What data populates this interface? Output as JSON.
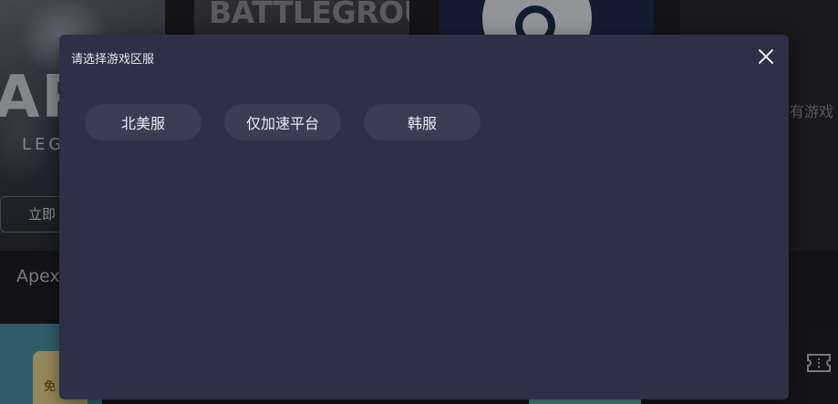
{
  "background": {
    "apex_tile": {
      "logo_text": "AP",
      "subtitle": "LEG",
      "play_button_label": "立即"
    },
    "pubg_tile": {
      "title": "BATTLEGROUNDS"
    },
    "all_games_label": "有游戏",
    "apex_name_label": "Apex",
    "bottom_card_text": "免"
  },
  "dialog": {
    "title": "请选择游戏区服",
    "close_icon": "close-icon",
    "regions": [
      {
        "label": "北美服"
      },
      {
        "label": "仅加速平台"
      },
      {
        "label": "韩服"
      }
    ]
  },
  "colors": {
    "dialog_bg": "#2d3046",
    "region_button_bg": "#3a3e55",
    "text": "#e8e9ef"
  }
}
